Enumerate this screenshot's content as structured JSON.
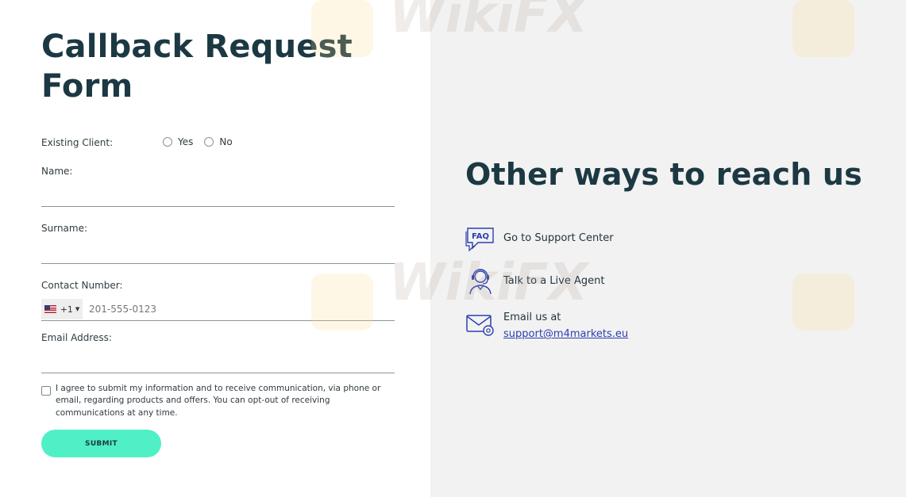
{
  "form": {
    "title": "Callback Request Form",
    "existing_client_label": "Existing Client:",
    "radio_yes": "Yes",
    "radio_no": "No",
    "name_label": "Name:",
    "surname_label": "Surname:",
    "contact_label": "Contact Number:",
    "country_code": "+1",
    "phone_placeholder": "201-555-0123",
    "email_label": "Email Address:",
    "consent_text": "I agree to submit my information and to receive communication, via phone or email, regarding products and offers. You can opt-out of receiving communications at any time.",
    "submit_label": "SUBMIT"
  },
  "contact": {
    "title": "Other ways to reach us",
    "support_center": "Go to Support Center",
    "live_agent": "Talk to a Live Agent",
    "email_prefix": "Email us at",
    "email_address": "support@m4markets.eu"
  },
  "icons": {
    "faq": "faq-chat-icon",
    "agent": "headset-agent-icon",
    "email": "envelope-at-icon",
    "flag": "us-flag-icon"
  },
  "colors": {
    "accent": "#4ff0c5",
    "heading": "#1c3943",
    "link": "#2b3fb0",
    "icon": "#2b3fb0",
    "panel": "#f2f2f2"
  },
  "watermark": "WikiFX"
}
